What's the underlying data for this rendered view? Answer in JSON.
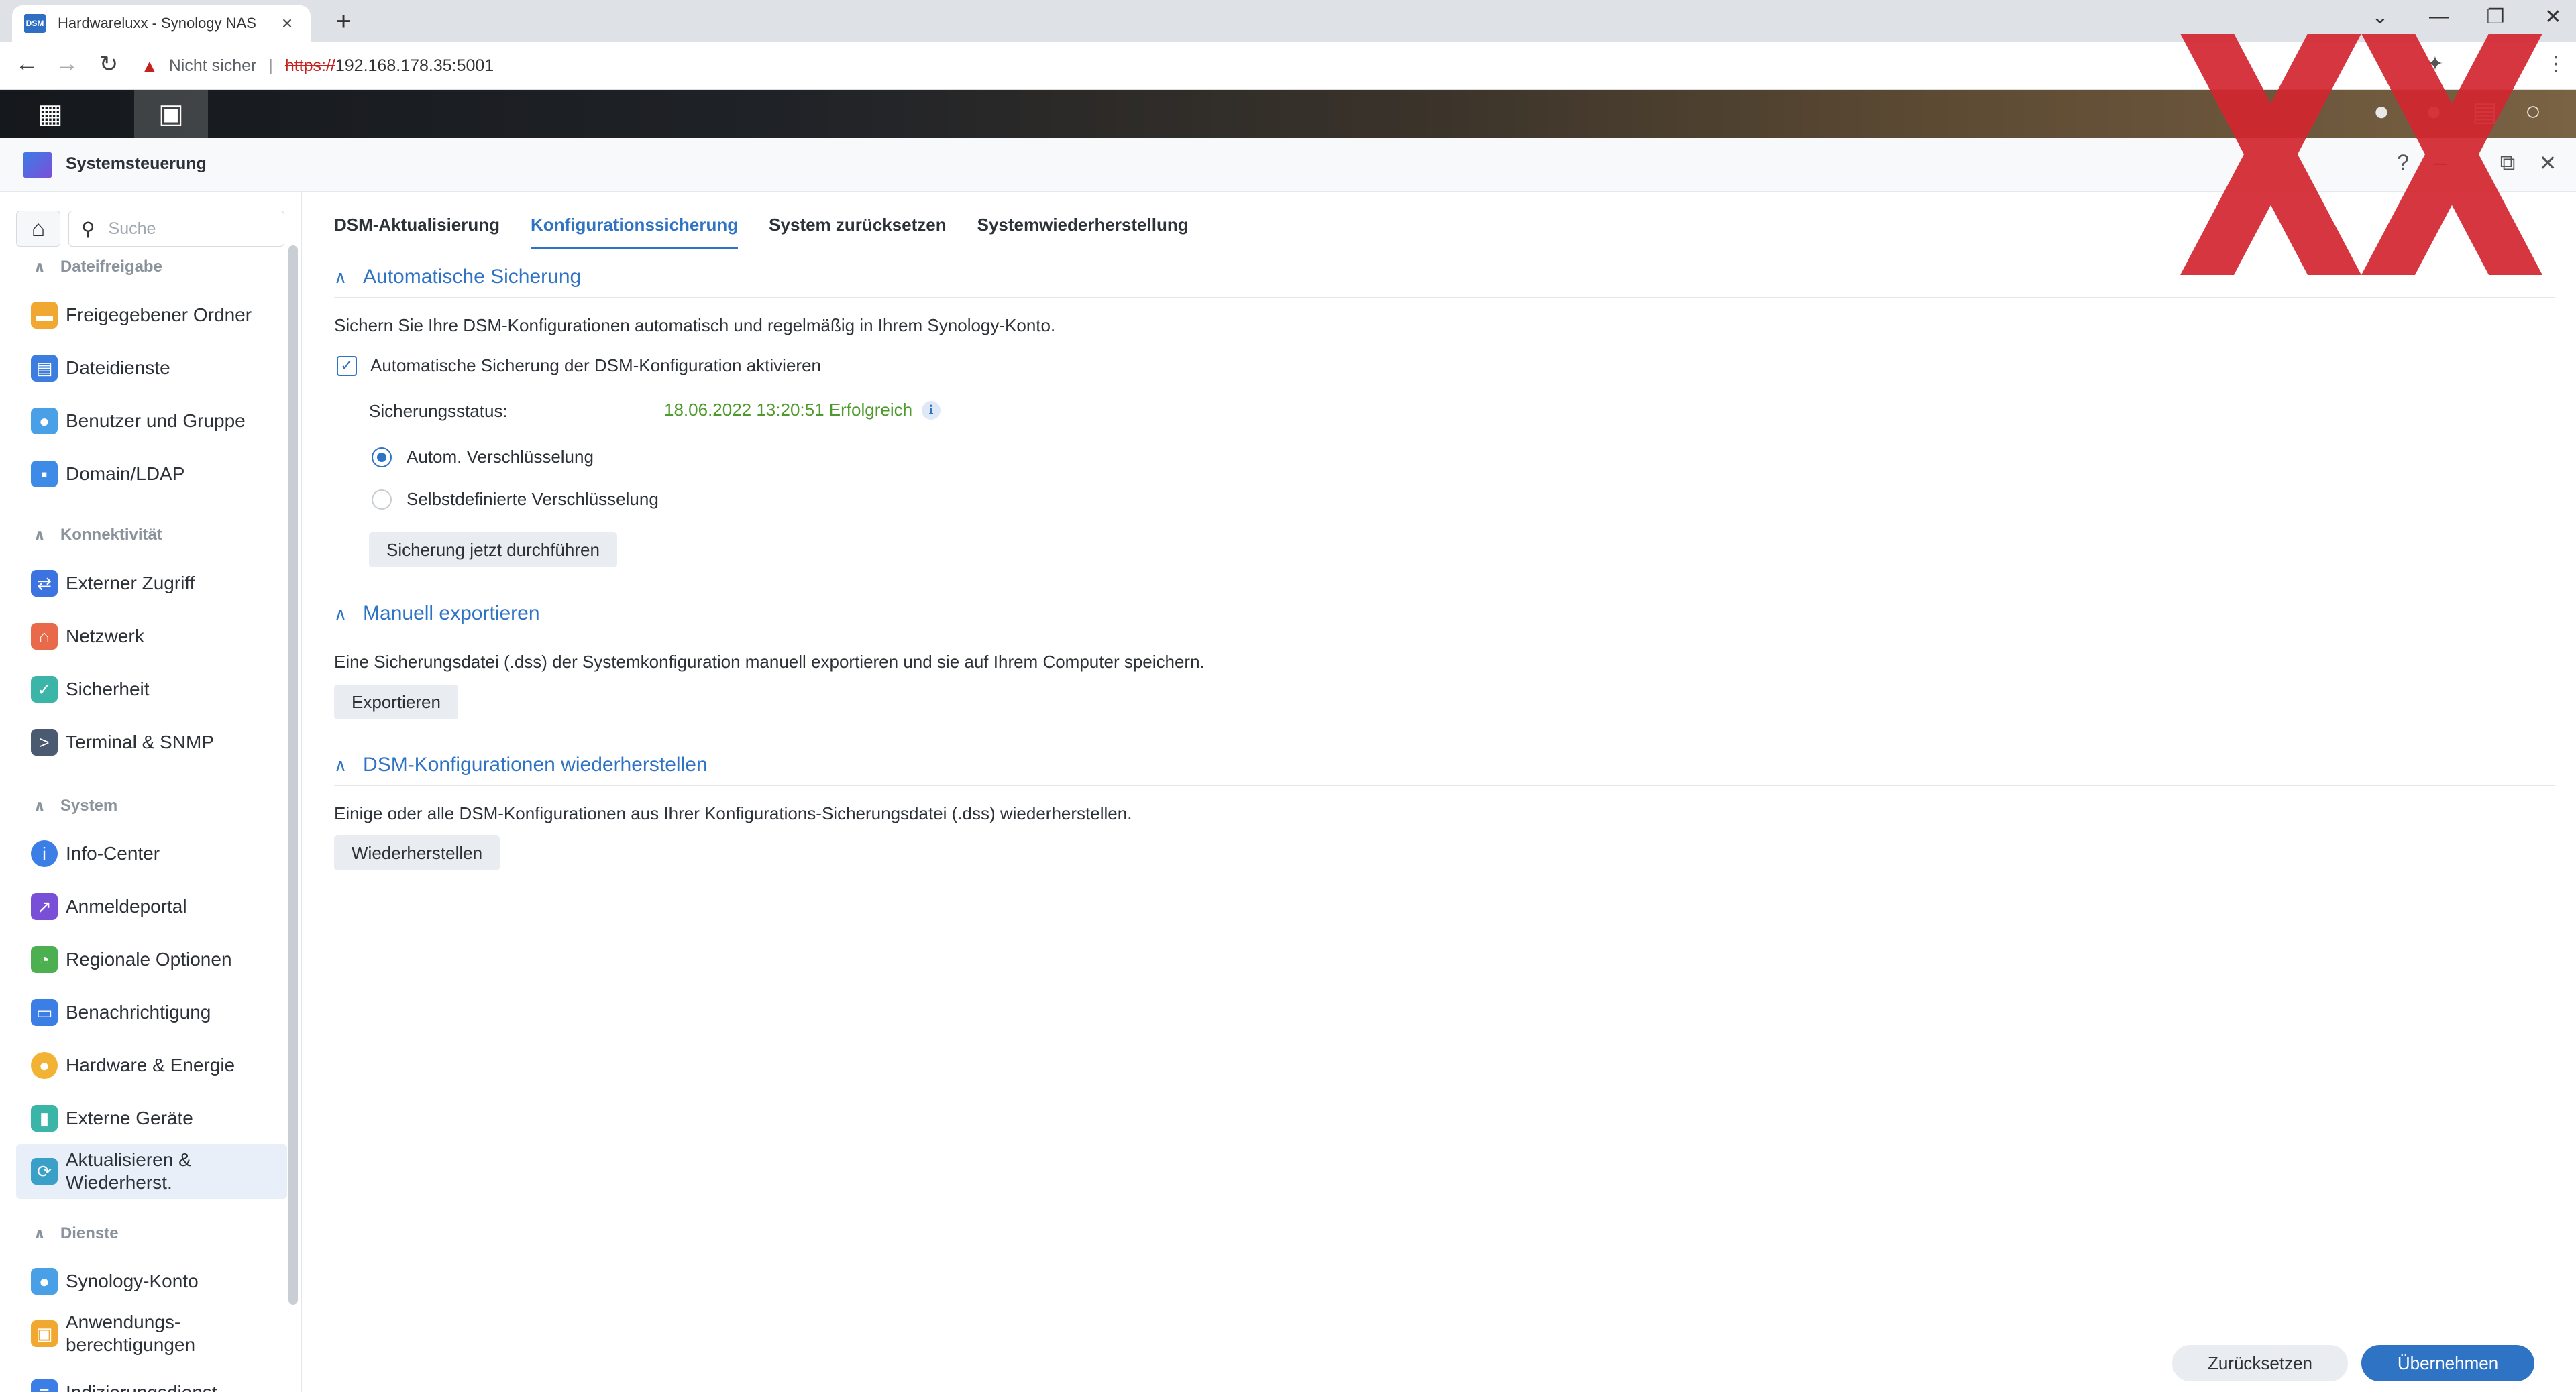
{
  "browser": {
    "tab_title": "Hardwareluxx - Synology NAS",
    "favicon_text": "DSM",
    "close_tab": "×",
    "new_tab": "+",
    "insecure_label": "Nicht sicher",
    "url_scheme": "https://",
    "url_rest": "192.168.178.35:5001"
  },
  "window": {
    "title": "Systemsteuerung"
  },
  "sidebar": {
    "search_placeholder": "Suche",
    "groups": [
      {
        "label": "Dateifreigabe"
      },
      {
        "label": "Konnektivität"
      },
      {
        "label": "System"
      },
      {
        "label": "Dienste"
      }
    ],
    "items": [
      {
        "label": "Freigegebener Ordner",
        "icon": "folder-icon",
        "color": "#f0a830"
      },
      {
        "label": "Dateidienste",
        "icon": "file-services-icon",
        "color": "#3c7ee0"
      },
      {
        "label": "Benutzer und Gruppe",
        "icon": "users-icon",
        "color": "#4aa0e6"
      },
      {
        "label": "Domain/LDAP",
        "icon": "domain-icon",
        "color": "#3d8be6"
      },
      {
        "label": "Externer Zugriff",
        "icon": "external-access-icon",
        "color": "#3b74e0"
      },
      {
        "label": "Netzwerk",
        "icon": "network-icon",
        "color": "#e86a4a"
      },
      {
        "label": "Sicherheit",
        "icon": "shield-icon",
        "color": "#3ab5a8"
      },
      {
        "label": "Terminal & SNMP",
        "icon": "terminal-icon",
        "color": "#4a5a70"
      },
      {
        "label": "Info-Center",
        "icon": "info-icon",
        "color": "#3a7ee6"
      },
      {
        "label": "Anmeldeportal",
        "icon": "login-portal-icon",
        "color": "#7a4fd8"
      },
      {
        "label": "Regionale Optionen",
        "icon": "regional-icon",
        "color": "#4caf50"
      },
      {
        "label": "Benachrichtigung",
        "icon": "notification-icon",
        "color": "#3a7ee6"
      },
      {
        "label": "Hardware & Energie",
        "icon": "bulb-icon",
        "color": "#f2b233"
      },
      {
        "label": "Externe Geräte",
        "icon": "external-device-icon",
        "color": "#3ab5a8"
      },
      {
        "label": "Aktualisieren & Wiederherst.",
        "icon": "update-icon",
        "color": "#3aa0c8"
      },
      {
        "label": "Synology-Konto",
        "icon": "account-icon",
        "color": "#4aa0e6"
      },
      {
        "label": "Anwendungs-berechtigungen",
        "icon": "lock-icon",
        "color": "#f0a830"
      },
      {
        "label": "Indizierungsdienst",
        "icon": "index-icon",
        "color": "#3a7ee6"
      }
    ]
  },
  "main": {
    "tabs": [
      {
        "label": "DSM-Aktualisierung"
      },
      {
        "label": "Konfigurationssicherung"
      },
      {
        "label": "System zurücksetzen"
      },
      {
        "label": "Systemwiederherstellung"
      }
    ],
    "auto_backup": {
      "heading": "Automatische Sicherung",
      "description": "Sichern Sie Ihre DSM-Konfigurationen automatisch und regelmäßig in Ihrem Synology-Konto.",
      "checkbox_label": "Automatische Sicherung der DSM-Konfiguration aktivieren",
      "checkbox_checked": true,
      "status_label": "Sicherungsstatus:",
      "status_value": "18.06.2022 13:20:51 Erfolgreich",
      "status_color": "#4e9a2c",
      "radio_auto": "Autom. Verschlüsselung",
      "radio_custom": "Selbstdefinierte Verschlüsselung",
      "selected_radio": "Autom. Verschlüsselung",
      "backup_now_button": "Sicherung jetzt durchführen"
    },
    "manual_export": {
      "heading": "Manuell exportieren",
      "description": "Eine Sicherungsdatei (.dss) der Systemkonfiguration manuell exportieren und sie auf Ihrem Computer speichern.",
      "export_button": "Exportieren"
    },
    "restore": {
      "heading": "DSM-Konfigurationen wiederherstellen",
      "description": "Einige oder alle DSM-Konfigurationen aus Ihrer Konfigurations-Sicherungsdatei (.dss) wiederherstellen.",
      "restore_button": "Wiederherstellen"
    },
    "footer": {
      "reset_button": "Zurücksetzen",
      "apply_button": "Übernehmen"
    }
  },
  "colors": {
    "accent": "#2f73c5",
    "success": "#4e9a2c",
    "watermark": "#d3262f"
  }
}
